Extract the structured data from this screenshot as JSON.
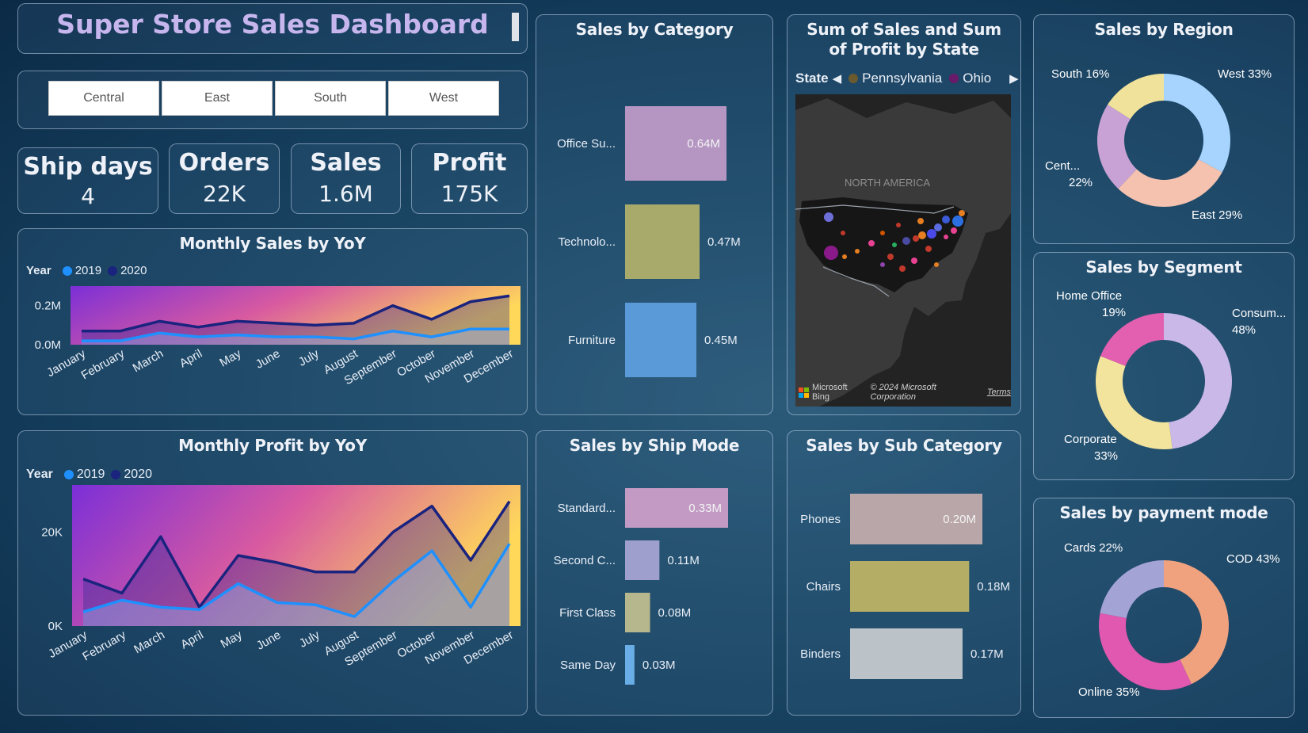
{
  "header": {
    "title": "Super Store Sales Dashboard"
  },
  "region_slicer": [
    "Central",
    "East",
    "South",
    "West"
  ],
  "kpis": [
    {
      "label": "Ship days",
      "value": "4"
    },
    {
      "label": "Orders",
      "value": "22K"
    },
    {
      "label": "Sales",
      "value": "1.6M"
    },
    {
      "label": "Profit",
      "value": "175K"
    }
  ],
  "colors": {
    "title": "#c7b6ee",
    "y2019": "#1e90ff",
    "y2020": "#1a237e"
  },
  "monthly_sales": {
    "title": "Monthly Sales by YoY",
    "legend_label": "Year",
    "chart_data": {
      "type": "area",
      "categories": [
        "January",
        "February",
        "March",
        "April",
        "May",
        "June",
        "July",
        "August",
        "September",
        "October",
        "November",
        "December"
      ],
      "series": [
        {
          "name": "2019",
          "values": [
            0.02,
            0.02,
            0.06,
            0.04,
            0.05,
            0.04,
            0.04,
            0.03,
            0.07,
            0.04,
            0.08,
            0.08
          ]
        },
        {
          "name": "2020",
          "values": [
            0.07,
            0.07,
            0.12,
            0.09,
            0.12,
            0.11,
            0.1,
            0.11,
            0.2,
            0.13,
            0.22,
            0.25
          ]
        }
      ],
      "ylim": [
        0,
        0.3
      ],
      "yticks": [
        {
          "v": 0,
          "label": "0.0M"
        },
        {
          "v": 0.2,
          "label": "0.2M"
        }
      ]
    }
  },
  "monthly_profit": {
    "title": "Monthly Profit by YoY",
    "legend_label": "Year",
    "chart_data": {
      "type": "area",
      "categories": [
        "January",
        "February",
        "March",
        "April",
        "May",
        "June",
        "July",
        "August",
        "September",
        "October",
        "November",
        "December"
      ],
      "series": [
        {
          "name": "2019",
          "values": [
            3000,
            5500,
            4000,
            3500,
            9000,
            5000,
            4500,
            2000,
            9500,
            16000,
            4000,
            17500
          ]
        },
        {
          "name": "2020",
          "values": [
            10000,
            7000,
            19000,
            4000,
            15000,
            13500,
            11500,
            11500,
            20000,
            25500,
            14000,
            26500
          ]
        }
      ],
      "ylim": [
        0,
        30000
      ],
      "yticks": [
        {
          "v": 0,
          "label": "0K"
        },
        {
          "v": 20000,
          "label": "20K"
        }
      ]
    }
  },
  "sales_by_category": {
    "title": "Sales by Category",
    "chart_data": {
      "type": "bar",
      "categories": [
        "Office Su...",
        "Technolo...",
        "Furniture"
      ],
      "values": [
        0.64,
        0.47,
        0.45
      ],
      "labels": [
        "0.64M",
        "0.47M",
        "0.45M"
      ],
      "colors": [
        "#b596c2",
        "#a8aa6b",
        "#5b9ad8"
      ]
    }
  },
  "state_map": {
    "title": "Sum of Sales and Sum of Profit by State",
    "legend_label": "State",
    "legend_items": [
      {
        "name": "Pennsylvania",
        "color": "#6b5a2e"
      },
      {
        "name": "Ohio",
        "color": "#6a1a6a"
      }
    ],
    "continent_label": "NORTH AMERICA",
    "copyright": "© 2024 Microsoft Corporation",
    "terms_link": "Terms",
    "brand": "Microsoft Bing"
  },
  "sales_by_region": {
    "title": "Sales by Region",
    "chart_data": {
      "type": "pie",
      "labels": [
        "West",
        "East",
        "Central",
        "South"
      ],
      "values": [
        33,
        29,
        22,
        16
      ],
      "colors": [
        "#a6d4ff",
        "#f4c2ae",
        "#c8a2d4",
        "#f0e29a"
      ]
    },
    "labels": {
      "west": "West 33%",
      "east": "East 29%",
      "central_1": "Cent...",
      "central_2": "22%",
      "south": "South 16%"
    }
  },
  "sales_by_segment": {
    "title": "Sales by Segment",
    "chart_data": {
      "type": "pie",
      "labels": [
        "Consumer",
        "Corporate",
        "Home Office"
      ],
      "values": [
        48,
        33,
        19
      ],
      "colors": [
        "#c9b8e8",
        "#f2e49c",
        "#e35fb0"
      ]
    },
    "labels": {
      "consumer_1": "Consum...",
      "consumer_2": "48%",
      "corporate_1": "Corporate",
      "corporate_2": "33%",
      "home_1": "Home Office",
      "home_2": "19%"
    }
  },
  "sales_by_ship_mode": {
    "title": "Sales by Ship Mode",
    "chart_data": {
      "type": "bar",
      "categories": [
        "Standard...",
        "Second C...",
        "First Class",
        "Same Day"
      ],
      "values": [
        0.33,
        0.11,
        0.08,
        0.03
      ],
      "labels": [
        "0.33M",
        "0.11M",
        "0.08M",
        "0.03M"
      ],
      "colors": [
        "#c29ac4",
        "#9f9fce",
        "#b6b78c",
        "#6aaee8"
      ]
    }
  },
  "sales_by_sub_category": {
    "title": "Sales by Sub Category",
    "chart_data": {
      "type": "bar",
      "categories": [
        "Phones",
        "Chairs",
        "Binders"
      ],
      "values": [
        0.2,
        0.18,
        0.17
      ],
      "labels": [
        "0.20M",
        "0.18M",
        "0.17M"
      ],
      "colors": [
        "#b9a6a9",
        "#b4ad65",
        "#bcc3c8"
      ]
    }
  },
  "sales_by_payment_mode": {
    "title": "Sales by payment mode",
    "chart_data": {
      "type": "pie",
      "labels": [
        "COD",
        "Online",
        "Cards"
      ],
      "values": [
        43,
        35,
        22
      ],
      "colors": [
        "#f0a27e",
        "#e058b0",
        "#a4a3d6"
      ]
    },
    "labels": {
      "cod": "COD 43%",
      "online": "Online 35%",
      "cards": "Cards 22%"
    }
  }
}
